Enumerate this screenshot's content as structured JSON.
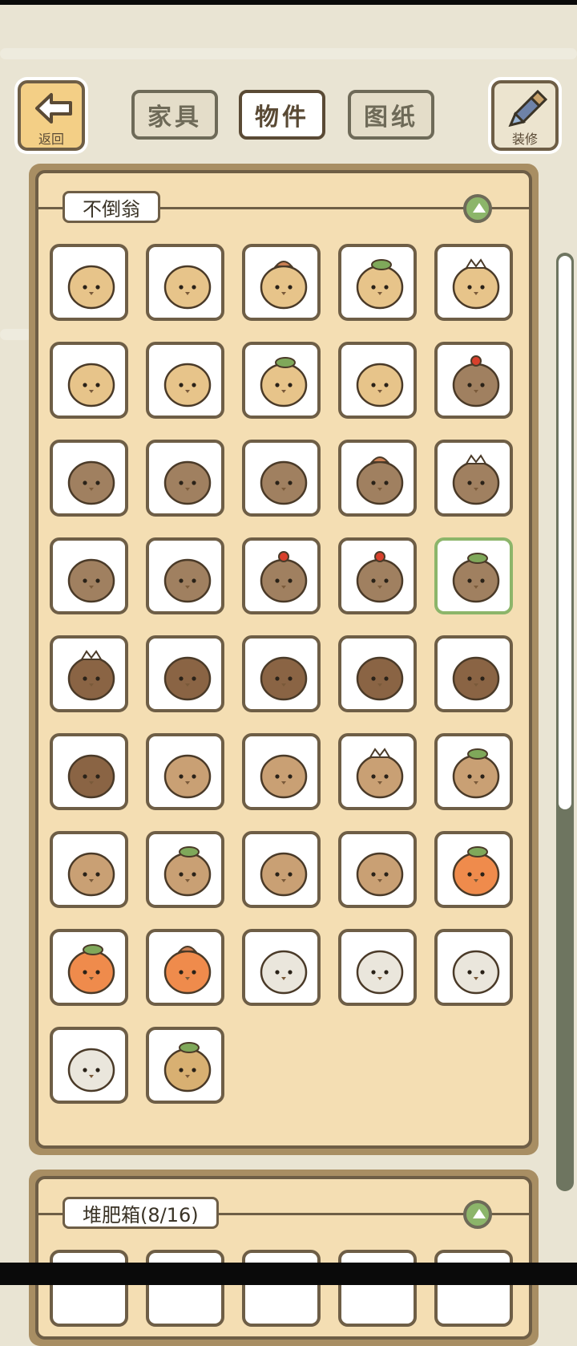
{
  "header": {
    "back_label": "返回",
    "decorate_label": "装修",
    "tabs": [
      {
        "label": "家具",
        "active": false
      },
      {
        "label": "物件",
        "active": true
      },
      {
        "label": "图纸",
        "active": false
      }
    ]
  },
  "sections": [
    {
      "title": "不倒翁",
      "item_count": 42,
      "selected_index": 19
    },
    {
      "title": "堆肥箱(8/16)"
    }
  ],
  "items": [
    {
      "icon": "egg-tan-icon"
    },
    {
      "icon": "egg-tan-icon"
    },
    {
      "icon": "egg-mushroom-icon"
    },
    {
      "icon": "egg-leaf-icon"
    },
    {
      "icon": "egg-flower-icon"
    },
    {
      "icon": "egg-tan-icon"
    },
    {
      "icon": "egg-spot-icon"
    },
    {
      "icon": "egg-leaf-icon"
    },
    {
      "icon": "egg-tan-icon"
    },
    {
      "icon": "acorn-berry-icon"
    },
    {
      "icon": "acorn-owl-icon"
    },
    {
      "icon": "acorn-icon"
    },
    {
      "icon": "acorn-icon"
    },
    {
      "icon": "acorn-mushroom-icon"
    },
    {
      "icon": "acorn-flower-icon"
    },
    {
      "icon": "acorn-dark-icon"
    },
    {
      "icon": "acorn-owl-icon"
    },
    {
      "icon": "acorn-berry-icon"
    },
    {
      "icon": "acorn-berry-icon"
    },
    {
      "icon": "acorn-sprout-icon"
    },
    {
      "icon": "chestnut-flower-icon"
    },
    {
      "icon": "chestnut-icon"
    },
    {
      "icon": "chestnut-icon"
    },
    {
      "icon": "chestnut-icon"
    },
    {
      "icon": "chestnut-icon"
    },
    {
      "icon": "chestnut-icon"
    },
    {
      "icon": "nut-light-icon"
    },
    {
      "icon": "nut-light-icon"
    },
    {
      "icon": "nut-flower-icon"
    },
    {
      "icon": "nut-sprout-icon"
    },
    {
      "icon": "nut-light-icon"
    },
    {
      "icon": "nut-leaf-icon"
    },
    {
      "icon": "nut-light-icon"
    },
    {
      "icon": "nut-light-icon"
    },
    {
      "icon": "pumpkin-icon"
    },
    {
      "icon": "pumpkin-icon"
    },
    {
      "icon": "pumpkin-mushroom-icon"
    },
    {
      "icon": "shell-icon"
    },
    {
      "icon": "shell-icon"
    },
    {
      "icon": "shell-icon"
    },
    {
      "icon": "shell-icon"
    },
    {
      "icon": "turnip-icon"
    }
  ],
  "colors": {
    "background": "#e9e4d3",
    "panel_outer": "#a88e63",
    "panel_inner": "#f4deb3",
    "outline": "#6e5e46",
    "accent_green": "#8cb56a",
    "back_button": "#f3cf86"
  }
}
